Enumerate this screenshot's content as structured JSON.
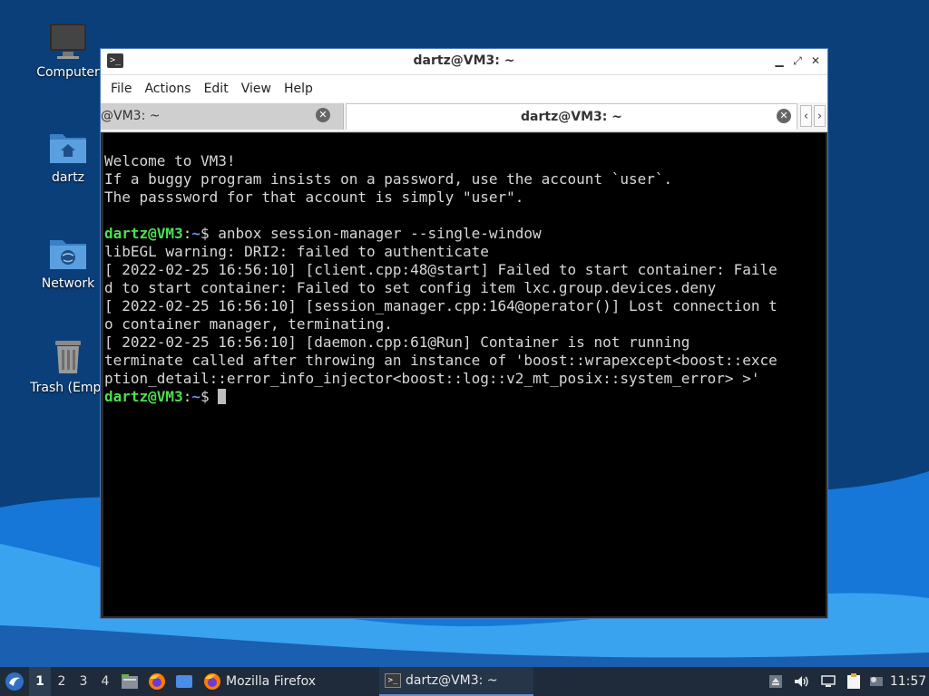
{
  "colors": {
    "desktop_bg": "#0b3f7a",
    "window_border": "#4c78b8",
    "terminal_bg": "#000000",
    "prompt_user": "#4de04d",
    "prompt_path": "#6f8fe8",
    "taskbar_bg": "#1f2b3a"
  },
  "desktop": {
    "icons": [
      {
        "label": "Computer",
        "icon": "computer-icon"
      },
      {
        "label": "dartz",
        "icon": "home-folder-icon"
      },
      {
        "label": "Network",
        "icon": "network-folder-icon"
      },
      {
        "label": "Trash (Empt",
        "icon": "trash-icon"
      }
    ]
  },
  "window": {
    "title": "dartz@VM3: ~",
    "controls": {
      "minimize": "▁",
      "maximize": "⤢",
      "close": "✕"
    },
    "menu": [
      "File",
      "Actions",
      "Edit",
      "View",
      "Help"
    ],
    "tabs": [
      {
        "label": "@VM3: ~",
        "active": false
      },
      {
        "label": "dartz@VM3: ~",
        "active": true
      }
    ],
    "tab_nav": {
      "prev": "‹",
      "next": "›"
    }
  },
  "terminal": {
    "lines": [
      "Welcome to VM3!",
      "If a buggy program insists on a password, use the account `user`.",
      "The passsword for that account is simply \"user\".",
      "",
      "libEGL warning: DRI2: failed to authenticate",
      "[ 2022-02-25 16:56:10] [client.cpp:48@start] Failed to start container: Faile",
      "d to start container: Failed to set config item lxc.group.devices.deny",
      "[ 2022-02-25 16:56:10] [session_manager.cpp:164@operator()] Lost connection t",
      "o container manager, terminating.",
      "[ 2022-02-25 16:56:10] [daemon.cpp:61@Run] Container is not running",
      "terminate called after throwing an instance of 'boost::wrapexcept<boost::exce",
      "ption_detail::error_info_injector<boost::log::v2_mt_posix::system_error> >'"
    ],
    "prompt_user": "dartz@VM3",
    "prompt_sep": ":",
    "prompt_path": "~",
    "prompt_symbol": "$ ",
    "command1": "anbox session-manager --single-window"
  },
  "taskbar": {
    "workspaces": [
      "1",
      "2",
      "3",
      "4"
    ],
    "active_workspace": "1",
    "tasks": [
      {
        "label": "Mozilla Firefox",
        "icon": "firefox-icon"
      },
      {
        "label": "dartz@VM3: ~",
        "icon": "terminal-icon"
      }
    ],
    "clock": "11:57"
  }
}
